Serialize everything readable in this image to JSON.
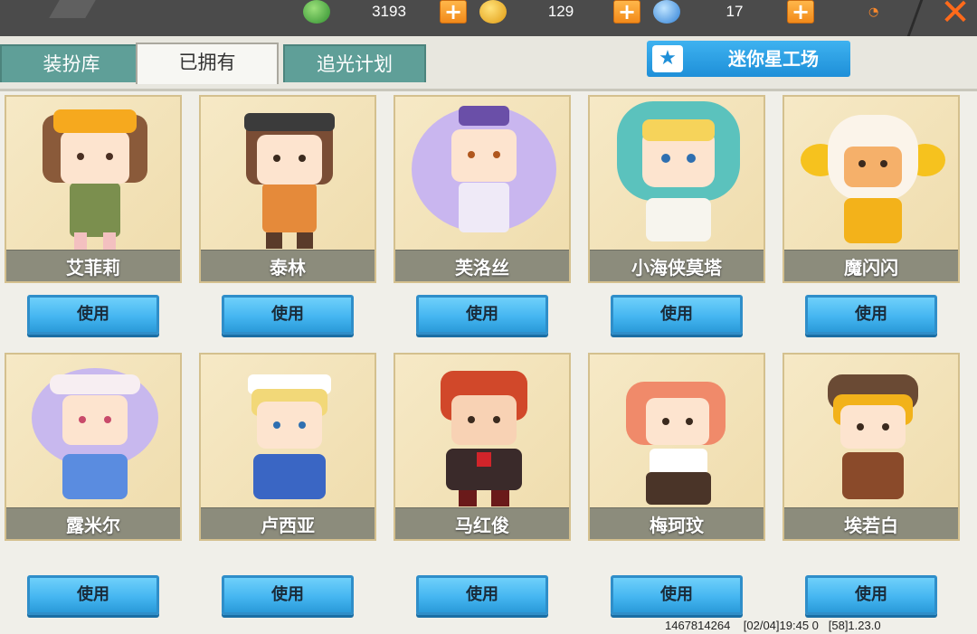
{
  "currencies": [
    {
      "name": "mini-bean",
      "icon": "green-gem-icon",
      "value": "3193",
      "color": "#3aa33a"
    },
    {
      "name": "mini-coin",
      "icon": "gold-coin-icon",
      "value": "129",
      "color": "#f2b21a"
    },
    {
      "name": "star-coin",
      "icon": "blue-star-coin-icon",
      "value": "17",
      "color": "#3a8fe0"
    }
  ],
  "tabs": [
    {
      "label": "装扮库",
      "active": false
    },
    {
      "label": "已拥有",
      "active": true
    },
    {
      "label": "追光计划",
      "active": false
    }
  ],
  "workshop_label": "迷你星工场",
  "characters": [
    {
      "name": "艾菲莉",
      "button": "使用"
    },
    {
      "name": "泰林",
      "button": "使用"
    },
    {
      "name": "芙洛丝",
      "button": "使用"
    },
    {
      "name": "小海侠莫塔",
      "button": "使用"
    },
    {
      "name": "魔闪闪",
      "button": "使用"
    },
    {
      "name": "露米尔",
      "button": "使用"
    },
    {
      "name": "卢西亚",
      "button": "使用"
    },
    {
      "name": "马红俊",
      "button": "使用"
    },
    {
      "name": "梅珂玟",
      "button": "使用"
    },
    {
      "name": "埃若白",
      "button": "使用"
    }
  ],
  "footer": {
    "uid": "1467814264",
    "time": "[02/04]19:45 0",
    "version": "[58]1.23.0"
  },
  "colors": {
    "tab": "#5f9f98",
    "button": "#45b6f1",
    "card": "#f6e9c6",
    "namebar": "#8c8c7c"
  }
}
